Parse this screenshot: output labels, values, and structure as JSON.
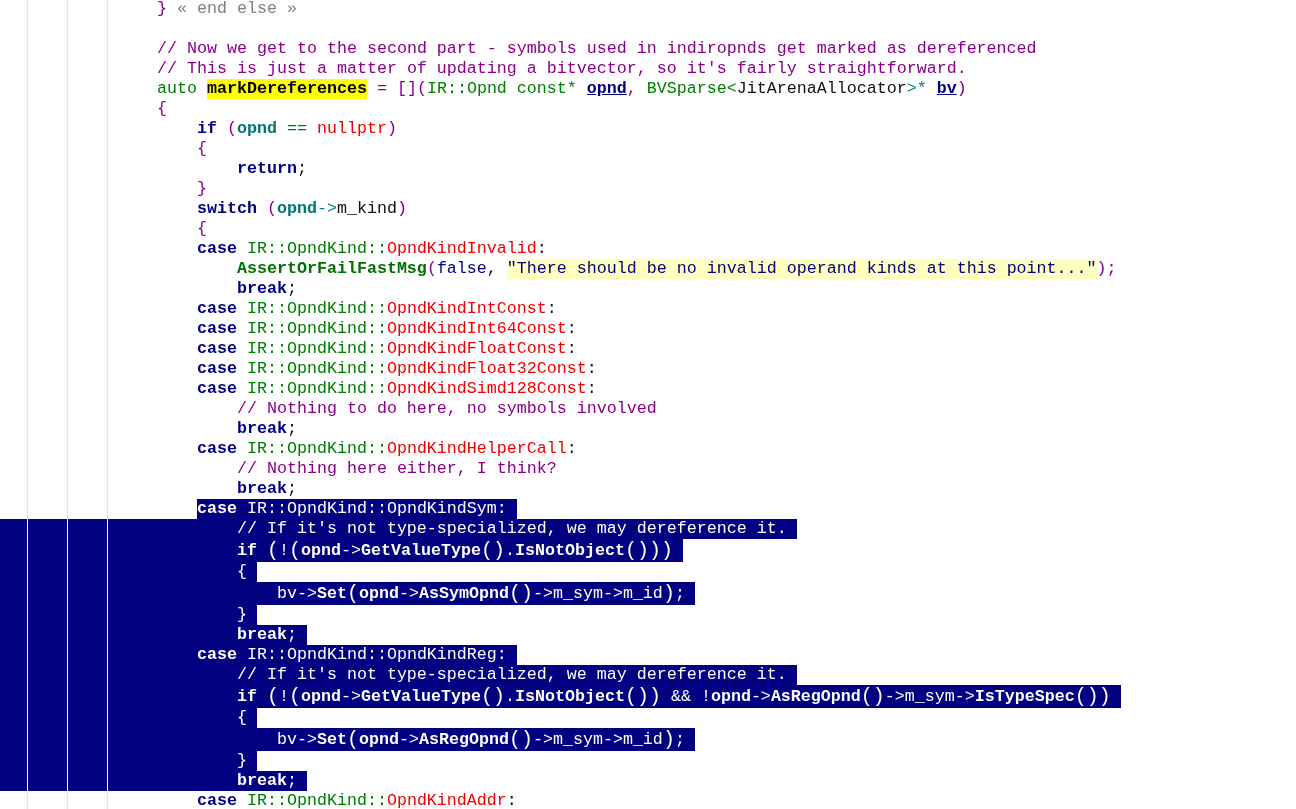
{
  "editor": {
    "lines": [
      {
        "selected": false,
        "tokens": [
          {
            "kind": "punct",
            "text": "}"
          },
          {
            "kind": "note",
            "text": " « end else »"
          }
        ]
      },
      {
        "selected": false
      },
      {
        "selected": false,
        "tokens": [
          {
            "kind": "comment",
            "text": "// Now we get to the second part - symbols used in indiropnds get marked as dereferenced"
          }
        ]
      },
      {
        "selected": false,
        "tokens": [
          {
            "kind": "comment",
            "text": "// This is just a matter of updating a bitvector, so it's fairly straightforward."
          }
        ]
      },
      {
        "selected": false,
        "tokens": [
          {
            "kind": "type",
            "text": "auto "
          },
          {
            "kind": "hl",
            "text": "markDereferences"
          },
          {
            "kind": "punct",
            "text": " = []("
          },
          {
            "kind": "type",
            "text": "IR::Opnd const* "
          },
          {
            "kind": "param",
            "text": "opnd"
          },
          {
            "kind": "punct",
            "text": ", "
          },
          {
            "kind": "type",
            "text": "BVSparse<"
          },
          {
            "kind": "plain",
            "text": "JitArenaAllocator"
          },
          {
            "kind": "op",
            "text": ">* "
          },
          {
            "kind": "param",
            "text": "bv"
          },
          {
            "kind": "punct",
            "text": ")"
          }
        ]
      },
      {
        "selected": false,
        "tokens": [
          {
            "kind": "punct",
            "text": "{"
          }
        ],
        "children": [
          {
            "selected": false,
            "tokens": [
              {
                "kind": "kw",
                "text": "if"
              },
              {
                "kind": "punct",
                "text": " ("
              },
              {
                "kind": "var",
                "text": "opnd"
              },
              {
                "kind": "type",
                "text": " == "
              },
              {
                "kind": "enum",
                "text": "nullptr"
              },
              {
                "kind": "punct",
                "text": ")"
              }
            ]
          },
          {
            "selected": false,
            "tokens": [
              {
                "kind": "punct",
                "text": "{"
              }
            ],
            "children": [
              {
                "selected": false,
                "tokens": [
                  {
                    "kind": "kw",
                    "text": "return"
                  },
                  {
                    "kind": "plain",
                    "text": ";"
                  }
                ]
              }
            ]
          },
          {
            "selected": false,
            "tokens": [
              {
                "kind": "punct",
                "text": "}"
              }
            ]
          },
          {
            "selected": false,
            "tokens": [
              {
                "kind": "kw",
                "text": "switch"
              },
              {
                "kind": "punct",
                "text": " ("
              },
              {
                "kind": "var",
                "text": "opnd"
              },
              {
                "kind": "op",
                "text": "->"
              },
              {
                "kind": "plain",
                "text": "m_kind"
              },
              {
                "kind": "punct",
                "text": ")"
              }
            ]
          },
          {
            "selected": false,
            "tokens": [
              {
                "kind": "punct",
                "text": "{"
              }
            ]
          },
          {
            "selected": false,
            "tokens": [
              {
                "kind": "kw",
                "text": "case"
              },
              {
                "kind": "type",
                "text": " IR::OpndKind::"
              },
              {
                "kind": "enum",
                "text": "OpndKindInvalid"
              },
              {
                "kind": "plain",
                "text": ":"
              }
            ],
            "children": [
              {
                "selected": false,
                "tokens": [
                  {
                    "kind": "func",
                    "text": "AssertOrFailFastMsg"
                  },
                  {
                    "kind": "punct",
                    "text": "("
                  },
                  {
                    "kind": "literal",
                    "text": "false"
                  },
                  {
                    "kind": "plain",
                    "text": ", "
                  },
                  {
                    "kind": "string",
                    "text": "\"There should be no invalid operand kinds at this point...\""
                  },
                  {
                    "kind": "punct",
                    "text": ");"
                  }
                ]
              },
              {
                "selected": false,
                "tokens": [
                  {
                    "kind": "kw",
                    "text": "break"
                  },
                  {
                    "kind": "plain",
                    "text": ";"
                  }
                ]
              }
            ]
          },
          {
            "selected": false,
            "tokens": [
              {
                "kind": "kw",
                "text": "case"
              },
              {
                "kind": "type",
                "text": " IR::OpndKind::"
              },
              {
                "kind": "enum",
                "text": "OpndKindIntConst"
              },
              {
                "kind": "plain",
                "text": ":"
              }
            ]
          },
          {
            "selected": false,
            "tokens": [
              {
                "kind": "kw",
                "text": "case"
              },
              {
                "kind": "type",
                "text": " IR::OpndKind::"
              },
              {
                "kind": "enum",
                "text": "OpndKindInt64Const"
              },
              {
                "kind": "plain",
                "text": ":"
              }
            ]
          },
          {
            "selected": false,
            "tokens": [
              {
                "kind": "kw",
                "text": "case"
              },
              {
                "kind": "type",
                "text": " IR::OpndKind::"
              },
              {
                "kind": "enum",
                "text": "OpndKindFloatConst"
              },
              {
                "kind": "plain",
                "text": ":"
              }
            ]
          },
          {
            "selected": false,
            "tokens": [
              {
                "kind": "kw",
                "text": "case"
              },
              {
                "kind": "type",
                "text": " IR::OpndKind::"
              },
              {
                "kind": "enum",
                "text": "OpndKindFloat32Const"
              },
              {
                "kind": "plain",
                "text": ":"
              }
            ]
          },
          {
            "selected": false,
            "tokens": [
              {
                "kind": "kw",
                "text": "case"
              },
              {
                "kind": "type",
                "text": " IR::OpndKind::"
              },
              {
                "kind": "enum",
                "text": "OpndKindSimd128Const"
              },
              {
                "kind": "plain",
                "text": ":"
              }
            ],
            "children": [
              {
                "selected": false,
                "tokens": [
                  {
                    "kind": "comment",
                    "text": "// Nothing to do here, no symbols involved"
                  }
                ]
              },
              {
                "selected": false,
                "tokens": [
                  {
                    "kind": "kw",
                    "text": "break"
                  },
                  {
                    "kind": "plain",
                    "text": ";"
                  }
                ]
              }
            ]
          },
          {
            "selected": false,
            "tokens": [
              {
                "kind": "kw",
                "text": "case"
              },
              {
                "kind": "type",
                "text": " IR::OpndKind::"
              },
              {
                "kind": "enum",
                "text": "OpndKindHelperCall"
              },
              {
                "kind": "plain",
                "text": ":"
              }
            ],
            "children": [
              {
                "selected": false,
                "tokens": [
                  {
                    "kind": "comment",
                    "text": "// Nothing here either, I think?"
                  }
                ]
              },
              {
                "selected": false,
                "tokens": [
                  {
                    "kind": "kw",
                    "text": "break"
                  },
                  {
                    "kind": "plain",
                    "text": ";"
                  }
                ]
              }
            ]
          },
          {
            "selected": true,
            "tokens": [
              {
                "kind": "kw",
                "text": "case"
              },
              {
                "kind": "type",
                "text": " IR::OpndKind::"
              },
              {
                "kind": "enum",
                "text": "OpndKindSym"
              },
              {
                "kind": "plain",
                "text": ":"
              }
            ],
            "children": [
              {
                "selected": true,
                "tokens": [
                  {
                    "kind": "comment",
                    "text": "// If it's not type-specialized, we may dereference it."
                  }
                ]
              },
              {
                "selected": true,
                "tokens": [
                  {
                    "kind": "kw",
                    "text": "if "
                  },
                  {
                    "kind": "bigpunct",
                    "text": "("
                  },
                  {
                    "kind": "plain",
                    "text": "!"
                  },
                  {
                    "kind": "bigpunct",
                    "text": "("
                  },
                  {
                    "kind": "var",
                    "text": "opnd"
                  },
                  {
                    "kind": "op",
                    "text": "->"
                  },
                  {
                    "kind": "func",
                    "text": "GetValueType"
                  },
                  {
                    "kind": "bigpunct",
                    "text": "()"
                  },
                  {
                    "kind": "plain",
                    "text": "."
                  },
                  {
                    "kind": "func",
                    "text": "IsNotObject"
                  },
                  {
                    "kind": "bigpunct",
                    "text": "()))"
                  }
                ]
              },
              {
                "selected": true,
                "tokens": [
                  {
                    "kind": "punct",
                    "text": "{"
                  }
                ],
                "children": [
                  {
                    "selected": true,
                    "tokens": [
                      {
                        "kind": "plain",
                        "text": "bv"
                      },
                      {
                        "kind": "op",
                        "text": "->"
                      },
                      {
                        "kind": "func",
                        "text": "Set"
                      },
                      {
                        "kind": "bigpunct",
                        "text": "("
                      },
                      {
                        "kind": "var",
                        "text": "opnd"
                      },
                      {
                        "kind": "op",
                        "text": "->"
                      },
                      {
                        "kind": "func",
                        "text": "AsSymOpnd"
                      },
                      {
                        "kind": "bigpunct",
                        "text": "()"
                      },
                      {
                        "kind": "plain",
                        "text": "->m_sym->m_id"
                      },
                      {
                        "kind": "bigpunct",
                        "text": ")"
                      },
                      {
                        "kind": "plain",
                        "text": ";"
                      }
                    ]
                  }
                ]
              },
              {
                "selected": true,
                "tokens": [
                  {
                    "kind": "punct",
                    "text": "}"
                  }
                ]
              },
              {
                "selected": true,
                "tokens": [
                  {
                    "kind": "kw",
                    "text": "break"
                  },
                  {
                    "kind": "plain",
                    "text": ";"
                  }
                ]
              }
            ]
          },
          {
            "selected": true,
            "tokens": [
              {
                "kind": "kw",
                "text": "case"
              },
              {
                "kind": "type",
                "text": " IR::OpndKind::"
              },
              {
                "kind": "enum",
                "text": "OpndKindReg"
              },
              {
                "kind": "plain",
                "text": ":"
              }
            ],
            "children": [
              {
                "selected": true,
                "tokens": [
                  {
                    "kind": "comment",
                    "text": "// If it's not type-specialized, we may dereference it."
                  }
                ]
              },
              {
                "selected": true,
                "tokens": [
                  {
                    "kind": "kw",
                    "text": "if "
                  },
                  {
                    "kind": "bigpunct",
                    "text": "("
                  },
                  {
                    "kind": "plain",
                    "text": "!"
                  },
                  {
                    "kind": "bigpunct",
                    "text": "("
                  },
                  {
                    "kind": "var",
                    "text": "opnd"
                  },
                  {
                    "kind": "op",
                    "text": "->"
                  },
                  {
                    "kind": "func",
                    "text": "GetValueType"
                  },
                  {
                    "kind": "bigpunct",
                    "text": "()"
                  },
                  {
                    "kind": "plain",
                    "text": "."
                  },
                  {
                    "kind": "func",
                    "text": "IsNotObject"
                  },
                  {
                    "kind": "bigpunct",
                    "text": "())"
                  },
                  {
                    "kind": "plain",
                    "text": " && !"
                  },
                  {
                    "kind": "var",
                    "text": "opnd"
                  },
                  {
                    "kind": "op",
                    "text": "->"
                  },
                  {
                    "kind": "func",
                    "text": "AsRegOpnd"
                  },
                  {
                    "kind": "bigpunct",
                    "text": "()"
                  },
                  {
                    "kind": "plain",
                    "text": "->m_sym->"
                  },
                  {
                    "kind": "func",
                    "text": "IsTypeSpec"
                  },
                  {
                    "kind": "bigpunct",
                    "text": "())"
                  }
                ]
              },
              {
                "selected": true,
                "tokens": [
                  {
                    "kind": "punct",
                    "text": "{"
                  }
                ],
                "children": [
                  {
                    "selected": true,
                    "tokens": [
                      {
                        "kind": "plain",
                        "text": "bv"
                      },
                      {
                        "kind": "op",
                        "text": "->"
                      },
                      {
                        "kind": "func",
                        "text": "Set"
                      },
                      {
                        "kind": "bigpunct",
                        "text": "("
                      },
                      {
                        "kind": "var",
                        "text": "opnd"
                      },
                      {
                        "kind": "op",
                        "text": "->"
                      },
                      {
                        "kind": "func",
                        "text": "AsRegOpnd"
                      },
                      {
                        "kind": "bigpunct",
                        "text": "()"
                      },
                      {
                        "kind": "plain",
                        "text": "->m_sym->m_id"
                      },
                      {
                        "kind": "bigpunct",
                        "text": ")"
                      },
                      {
                        "kind": "plain",
                        "text": ";"
                      }
                    ]
                  }
                ]
              },
              {
                "selected": true,
                "tokens": [
                  {
                    "kind": "punct",
                    "text": "}"
                  }
                ]
              },
              {
                "selected": true,
                "tokens": [
                  {
                    "kind": "kw",
                    "text": "break"
                  },
                  {
                    "kind": "plain",
                    "text": ";"
                  }
                ]
              }
            ]
          },
          {
            "selected": false,
            "tokens": [
              {
                "kind": "kw",
                "text": "case"
              },
              {
                "kind": "type",
                "text": " IR::OpndKind::"
              },
              {
                "kind": "enum",
                "text": "OpndKindAddr"
              },
              {
                "kind": "plain",
                "text": ":"
              }
            ]
          }
        ]
      }
    ]
  }
}
